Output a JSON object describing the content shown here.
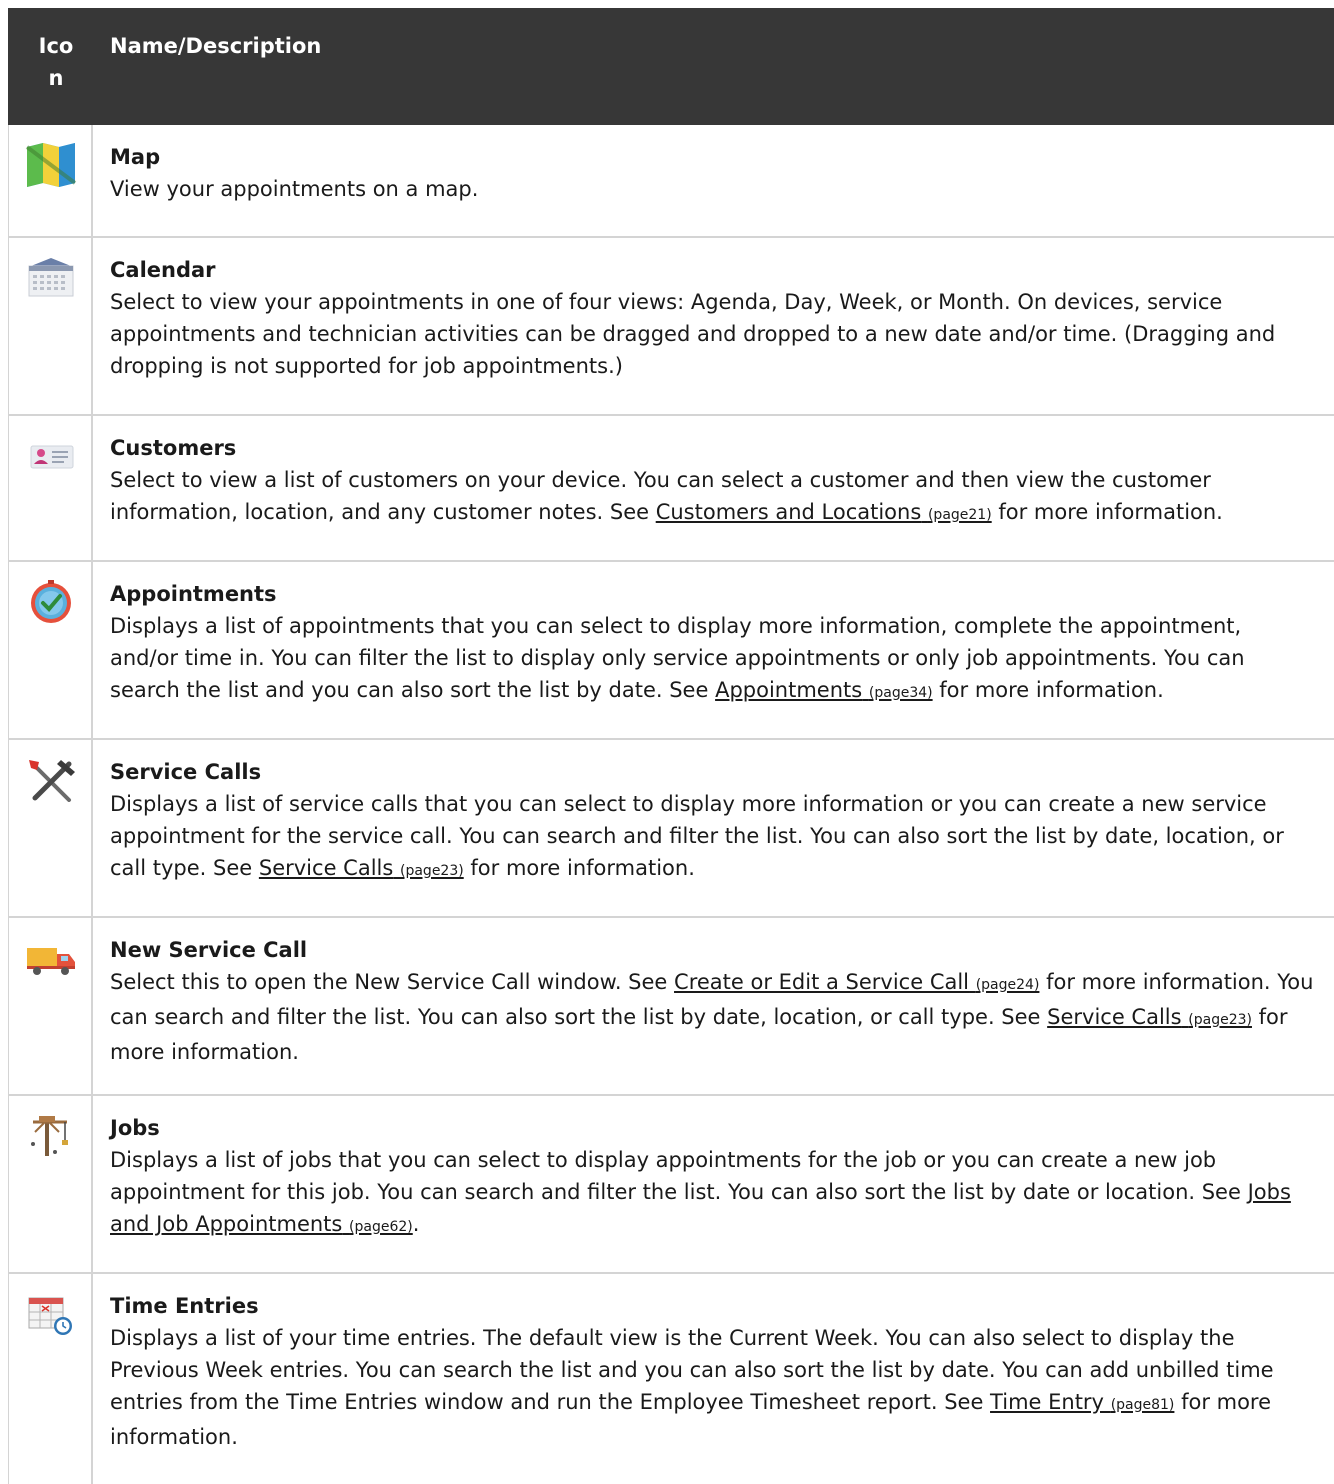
{
  "header": {
    "icon_col": "Icon",
    "name_col": "Name/Description"
  },
  "rows": [
    {
      "title": "Map",
      "desc_pre": "View your appointments on a map."
    },
    {
      "title": "Calendar",
      "desc_pre": "Select to view your appointments in one of four views: Agenda, Day, Week, or Month. On devices, service appointments and technician activities can be dragged and dropped to a new date and/or time. (Dragging and dropping is not supported for job appointments.)"
    },
    {
      "title": "Customers",
      "desc_pre": "Select to view a list of customers on your device. You can select a customer and then view the customer information, location, and any customer notes. See ",
      "link1": "Customers and Locations",
      "link1_page": "(page21)",
      "desc_post": " for more information."
    },
    {
      "title": "Appointments",
      "desc_pre": "Displays a list of appointments that you can select to display more information, complete the appointment, and/or time in. You can filter the list to display only service appointments or only job appointments. You can search the list and you can also sort the list by date. See ",
      "link1": "Appointments",
      "link1_page": "(page34)",
      "desc_post": " for more information."
    },
    {
      "title": "Service Calls",
      "desc_pre": "Displays a list of service calls that you can select to display more information or you can create a new service appointment for the service call. You can search and filter the list. You can also sort the list by date, location, or call type. See ",
      "link1": "Service Calls",
      "link1_page": "(page23)",
      "desc_post": " for more information."
    },
    {
      "title": "New Service Call",
      "desc_pre": "Select this to open the New Service Call window. See ",
      "link1": "Create or Edit a Service Call",
      "link1_page": "(page24)",
      "desc_mid": " for more information. You can search and filter the list. You can also sort the list by date, location, or call type. See ",
      "link2": "Service Calls",
      "link2_page": "(page23)",
      "desc_post": " for more information."
    },
    {
      "title": "Jobs",
      "desc_pre": "Displays a list of jobs that you can select to display appointments for the job or you can create a new job appointment for this job. You can search and filter the list. You can also sort the list by date or location. See ",
      "link1": "Jobs and Job Appointments",
      "link1_page": "(page62)",
      "desc_post": "."
    },
    {
      "title": "Time Entries",
      "desc_pre": "Displays a list of your time entries. The default view is the Current Week. You can also select to display the Previous Week entries. You can search the list and you can also sort the list by date. You can add unbilled time entries from the Time Entries window and run the Employee Timesheet report. See ",
      "link1": "Time Entry",
      "link1_page": "(page81)",
      "desc_post": " for more information."
    }
  ],
  "icons": [
    "map-icon",
    "calendar-icon",
    "customers-icon",
    "appointments-icon",
    "service-calls-icon",
    "new-service-call-icon",
    "jobs-icon",
    "time-entries-icon"
  ]
}
